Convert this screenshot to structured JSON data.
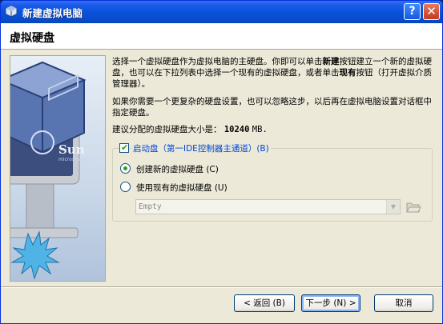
{
  "window": {
    "title": "新建虚拟电脑",
    "help_symbol": "?",
    "close_symbol": "✕",
    "icon": "virtualbox-app-icon"
  },
  "header": {
    "title": "虚拟硬盘"
  },
  "graphic": {
    "logo_text": "Sun",
    "logo_subtext": "microsystems",
    "icon": "virtualbox-cube-illustration"
  },
  "description": {
    "p1_a": "选择一个虚拟硬盘作为虚拟电脑的主硬盘。你即可以单击",
    "p1_bold1": "新建",
    "p1_b": "按钮建立一个新的虚拟硬盘，也可以在下拉列表中选择一个现有的虚拟硬盘，或者单击",
    "p1_bold2": "现有",
    "p1_c": "按钮（打开虚拟介质管理器）。",
    "p2": "如果你需要一个更复杂的硬盘设置，也可以忽略这步，以后再在虚拟电脑设置对话框中指定硬盘。",
    "size_label": "建议分配的虚拟硬盘大小是：",
    "size_value": "10240",
    "size_unit": "MB."
  },
  "boot_group": {
    "checkbox_label": "启动盘（第一IDE控制器主通道）(B)",
    "checked": true,
    "option_new": "创建新的虚拟硬盘 (C)",
    "option_existing": "使用现有的虚拟硬盘 (U)",
    "selected": "new",
    "combo_value": "Empty",
    "combo_icon": "chevron-down-icon",
    "browse_icon": "folder-open-icon"
  },
  "buttons": {
    "back": "< 返回 (B)",
    "next": "下一步 (N) >",
    "cancel": "取消"
  }
}
